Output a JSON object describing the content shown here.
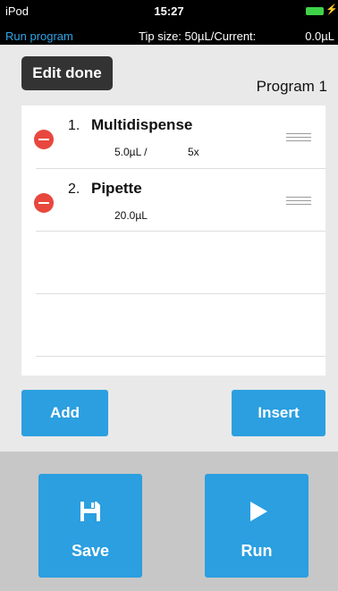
{
  "status_bar": {
    "carrier": "iPod",
    "time": "15:27",
    "mode": "Run program",
    "tip_size_text": "Tip size:  50µL/Current:",
    "current_value": "0.0µL"
  },
  "header": {
    "edit_done_label": "Edit done",
    "program_name": "Program 1"
  },
  "steps": [
    {
      "number": "1.",
      "name": "Multidispense",
      "volume": "5.0µL /",
      "repeats": "5x"
    },
    {
      "number": "2.",
      "name": "Pipette",
      "volume": "20.0µL",
      "repeats": ""
    }
  ],
  "actions": {
    "add_label": "Add",
    "insert_label": "Insert",
    "save_label": "Save",
    "run_label": "Run"
  },
  "colors": {
    "accent": "#2b9fe0",
    "delete": "#e8473e",
    "battery": "#3fd34a"
  },
  "icons": [
    "save-icon",
    "play-icon",
    "remove-icon",
    "drag-handle-icon"
  ]
}
